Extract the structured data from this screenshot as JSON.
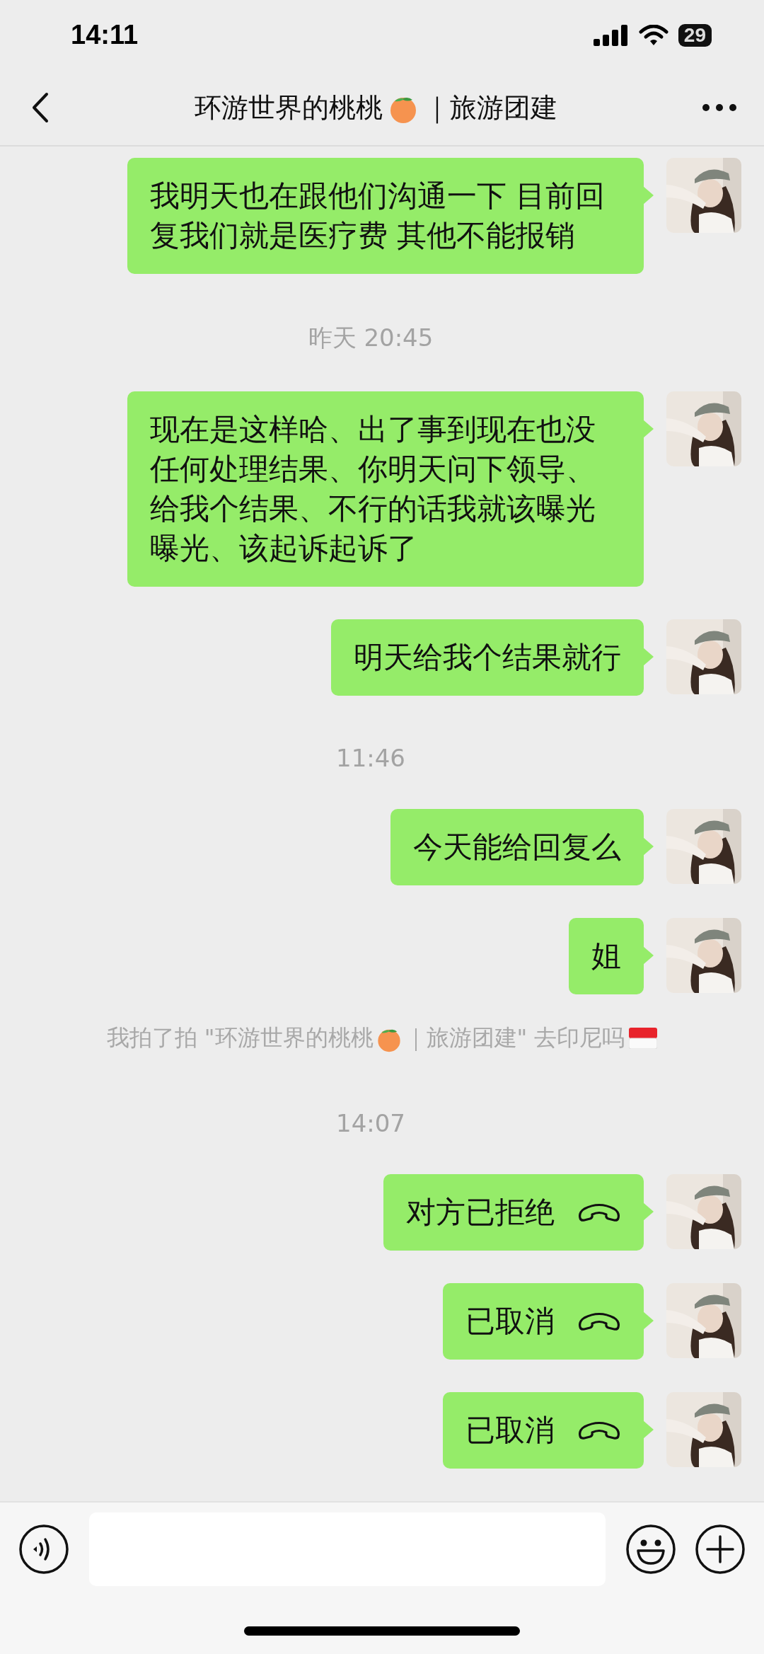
{
  "status_bar": {
    "time": "14:11",
    "battery": "29"
  },
  "nav": {
    "name": "环游世界的桃桃",
    "suffix": "｜旅游团建"
  },
  "messages": [
    {
      "kind": "text",
      "text": "我明天也在跟他们沟通一下 目前回复我们就是医疗费 其他不能报销"
    },
    {
      "kind": "time",
      "text": "昨天 20:45"
    },
    {
      "kind": "text",
      "text": "现在是这样哈、出了事到现在也没任何处理结果、你明天问下领导、给我个结果、不行的话我就该曝光曝光、该起诉起诉了"
    },
    {
      "kind": "text",
      "text": "明天给我个结果就行"
    },
    {
      "kind": "time",
      "text": "11:46"
    },
    {
      "kind": "text",
      "text": "今天能给回复么"
    },
    {
      "kind": "text",
      "text": "姐"
    },
    {
      "kind": "system",
      "parts": [
        {
          "kind": "text",
          "text": "我拍了拍 \"环游世界的桃桃"
        },
        {
          "kind": "peach"
        },
        {
          "kind": "text",
          "text": "｜旅游团建\" 去印尼吗"
        },
        {
          "kind": "flag"
        }
      ]
    },
    {
      "kind": "time",
      "text": "14:07"
    },
    {
      "kind": "call",
      "text": "对方已拒绝"
    },
    {
      "kind": "call",
      "text": "已取消"
    },
    {
      "kind": "call",
      "text": "已取消"
    }
  ]
}
